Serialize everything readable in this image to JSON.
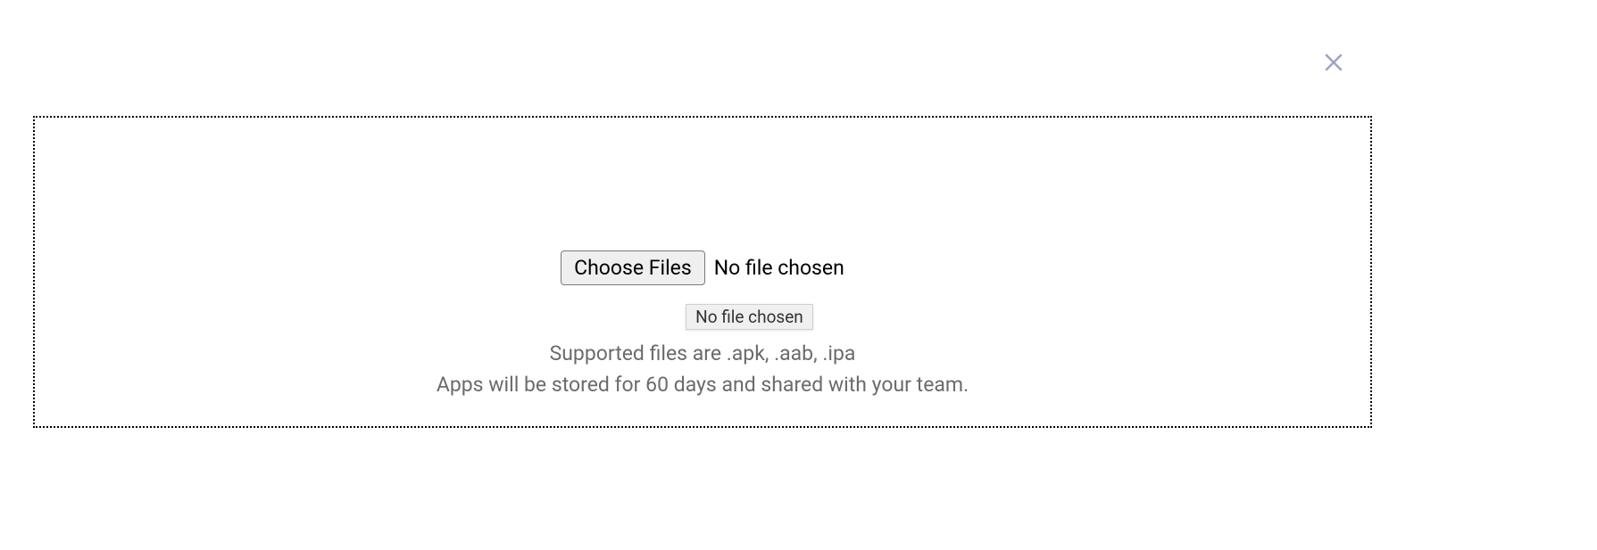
{
  "dialog": {
    "close_icon": "close-icon"
  },
  "upload": {
    "choose_button_label": "Choose Files",
    "file_status": "No file chosen",
    "tooltip_text": "No file chosen",
    "supported_text": "Supported files are .apk, .aab, .ipa",
    "storage_text": "Apps will be stored for 60 days and shared with your team."
  }
}
